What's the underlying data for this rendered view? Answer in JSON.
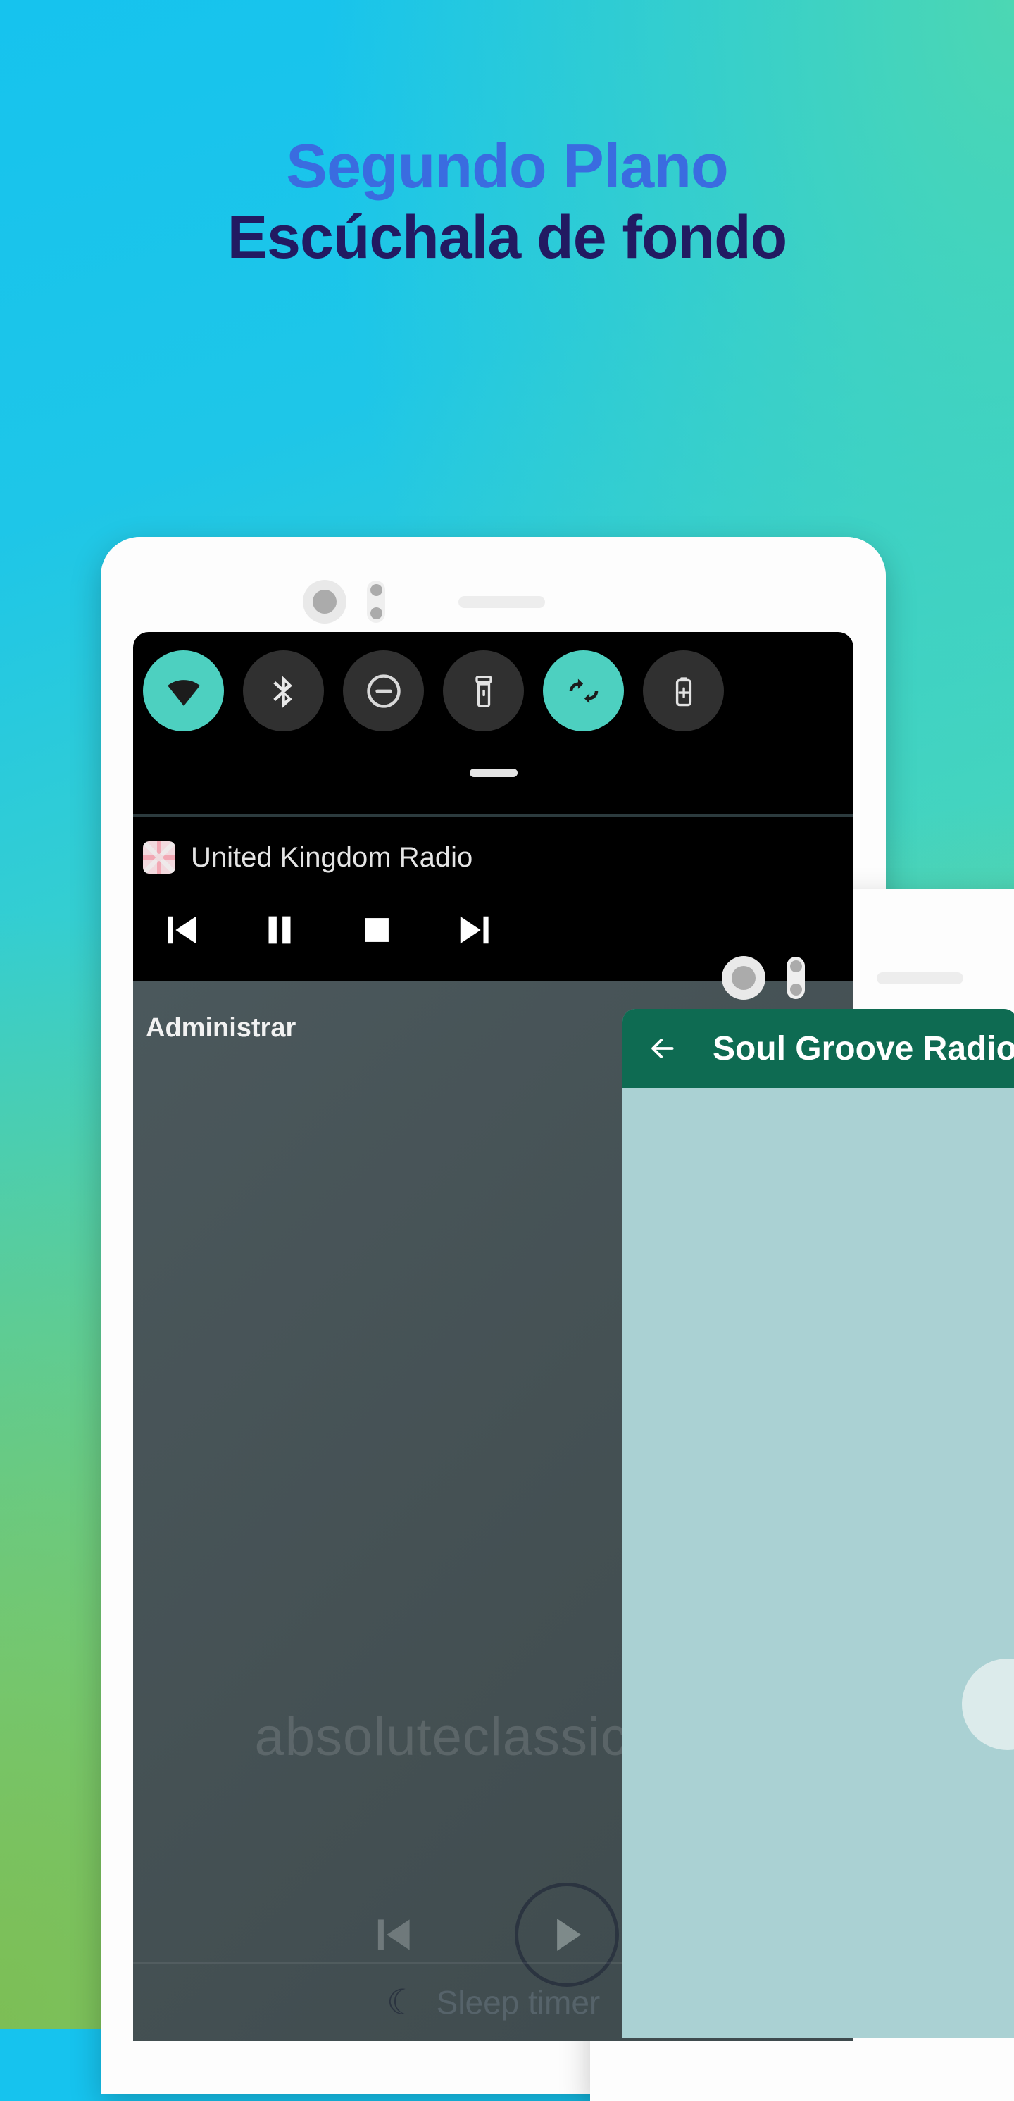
{
  "background": {
    "gradient_from": "#16C3EE",
    "gradient_mid": "#4CD7B3",
    "gradient_to": "#86C455"
  },
  "headline": {
    "line1": "Segundo Plano",
    "line1_color": "#3A6CE0",
    "line2": "Escúchala de fondo",
    "line2_color": "#221A62"
  },
  "phone1": {
    "quick_settings": {
      "accent_on": "#4DD0C0",
      "accent_off": "#303030",
      "tiles": [
        {
          "name": "wifi-tile",
          "icon": "wifi-icon",
          "active": true
        },
        {
          "name": "bluetooth-tile",
          "icon": "bluetooth-icon",
          "active": false
        },
        {
          "name": "do-not-disturb-tile",
          "icon": "do-not-disturb-icon",
          "active": false
        },
        {
          "name": "flashlight-tile",
          "icon": "flashlight-icon",
          "active": false
        },
        {
          "name": "auto-rotate-tile",
          "icon": "auto-rotate-icon",
          "active": true
        },
        {
          "name": "battery-saver-tile",
          "icon": "battery-saver-icon",
          "active": false
        }
      ]
    },
    "shade_handle": "drag-handle",
    "media_notification": {
      "app_icon": "united-kingdom-flag-icon",
      "title": "United Kingdom Radio",
      "controls": [
        {
          "name": "previous-button",
          "icon": "skip-previous-icon"
        },
        {
          "name": "pause-button",
          "icon": "pause-icon"
        },
        {
          "name": "stop-button",
          "icon": "stop-icon"
        },
        {
          "name": "next-button",
          "icon": "skip-next-icon"
        }
      ]
    },
    "app": {
      "section_label": "Administrar",
      "watermark_note": "♪",
      "station_watermark": "absoluteclassicrock",
      "playback": {
        "previous": "skip-previous-icon",
        "play": "play-icon"
      },
      "sleep_timer": {
        "icon": "moon-icon",
        "label": "Sleep timer"
      }
    }
  },
  "phone2": {
    "appbar": {
      "back_icon": "arrow-left-icon",
      "title": "Soul Groove Radio",
      "color": "#0E6B52"
    },
    "body_color": "#AAD1D3",
    "fab": "play-fab"
  }
}
